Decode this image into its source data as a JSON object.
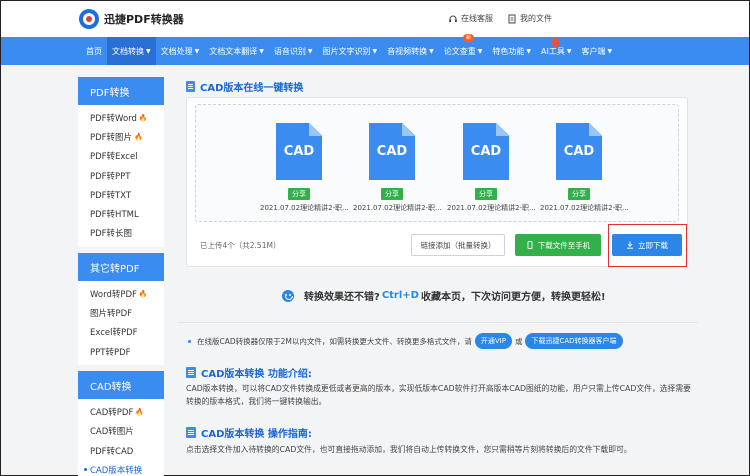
{
  "header": {
    "logo_text": "迅捷PDF转换器",
    "service_label": "在线客服",
    "files_label": "我的文件"
  },
  "nav": {
    "items": [
      {
        "label": "首页",
        "caret": ""
      },
      {
        "label": "文档转换",
        "caret": "▼"
      },
      {
        "label": "文档处理",
        "caret": "▼"
      },
      {
        "label": "文档文本翻译",
        "caret": "▼"
      },
      {
        "label": "语音识别",
        "caret": "▼"
      },
      {
        "label": "图片文字识别",
        "caret": "▼"
      },
      {
        "label": "音视频转换",
        "caret": "▼"
      },
      {
        "label": "论文查重",
        "caret": "▼"
      },
      {
        "label": "特色功能",
        "caret": "▼"
      },
      {
        "label": "AI工具",
        "caret": "▼"
      },
      {
        "label": "客户端",
        "caret": "▼"
      }
    ],
    "new_badge": "新"
  },
  "sidebar": {
    "groups": [
      {
        "title": "PDF转换",
        "items": [
          {
            "label": "PDF转Word",
            "hot": true
          },
          {
            "label": "PDF转图片",
            "hot": true
          },
          {
            "label": "PDF转Excel",
            "hot": false
          },
          {
            "label": "PDF转PPT",
            "hot": false
          },
          {
            "label": "PDF转TXT",
            "hot": false
          },
          {
            "label": "PDF转HTML",
            "hot": false
          },
          {
            "label": "PDF转长图",
            "hot": false
          }
        ]
      },
      {
        "title": "其它转PDF",
        "items": [
          {
            "label": "Word转PDF",
            "hot": true
          },
          {
            "label": "图片转PDF",
            "hot": false
          },
          {
            "label": "Excel转PDF",
            "hot": false
          },
          {
            "label": "PPT转PDF",
            "hot": false
          }
        ]
      },
      {
        "title": "CAD转换",
        "items": [
          {
            "label": "CAD转PDF",
            "hot": true
          },
          {
            "label": "CAD转图片",
            "hot": false
          },
          {
            "label": "PDF转CAD",
            "hot": false
          },
          {
            "label": "CAD版本转换",
            "hot": false,
            "current": true
          }
        ]
      }
    ]
  },
  "main": {
    "section_title": "CAD版本在线一键转换",
    "files": [
      {
        "icon_label": "CAD",
        "share": "分享",
        "name": "2021.07.02理论精讲2-职..."
      },
      {
        "icon_label": "CAD",
        "share": "分享",
        "name": "2021.07.02理论精讲2-职..."
      },
      {
        "icon_label": "CAD",
        "share": "分享",
        "name": "2021.07.02理论精讲2-职..."
      },
      {
        "icon_label": "CAD",
        "share": "分享",
        "name": "2021.07.02理论精讲2-职..."
      }
    ],
    "upload_info": "已上传4个（共2.51M）",
    "btn_link": "链接添加（批量转换）",
    "btn_phone": "下载文件至手机",
    "btn_download": "立即下载",
    "promo_a": "转换效果还不错?",
    "promo_kbd": "Ctrl+D",
    "promo_b": "收藏本页，下次访问更方便，转换更轻松!",
    "notice_text": "在线版CAD转换器仅限于2M以内文件，如需转换更大文件、转换更多格式文件，请",
    "notice_btn1": "开通VIP",
    "notice_or": "或",
    "notice_btn2": "下载迅捷CAD转换器客户端",
    "intro_title": "CAD版本转换 功能介绍:",
    "intro_text": "CAD版本转换，可以将CAD文件转换成更低或者更高的版本，实现低版本CAD软件打开高版本CAD图纸的功能，用户只需上传CAD文件，选择需要转换的版本格式，我们将一键转换输出。",
    "guide_title": "CAD版本转换 操作指南:",
    "guide_text": "点击选择文件加入待转换的CAD文件，也可直接拖动添加，我们将自动上传转换文件，您只需稍等片刻将转换后的文件下载即可。"
  },
  "colors": {
    "nav_bg": "#3a8cf0",
    "accent": "#1a65d8",
    "green": "#33b04a",
    "highlight": "#e03232"
  }
}
